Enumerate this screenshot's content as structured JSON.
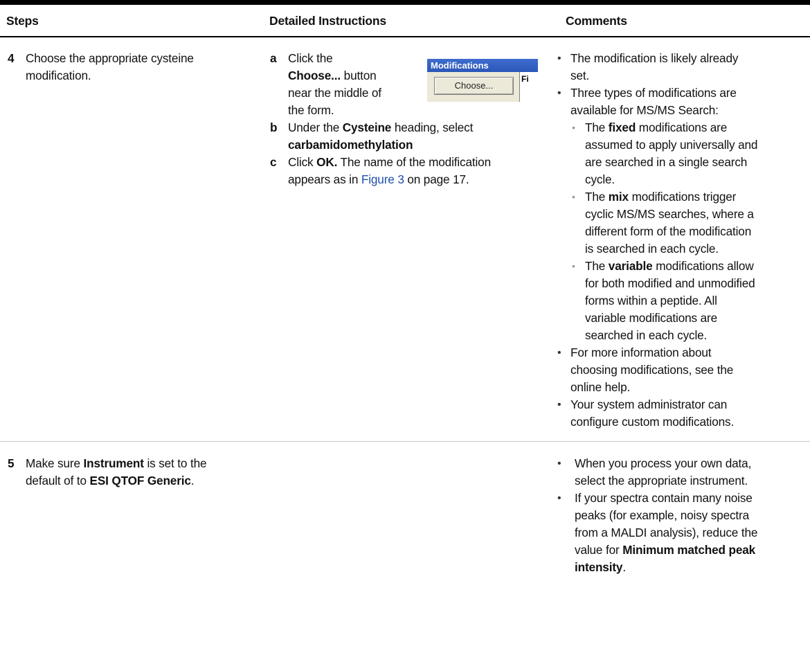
{
  "headers": {
    "steps": "Steps",
    "instructions": "Detailed Instructions",
    "comments": "Comments"
  },
  "step4": {
    "number": "4",
    "text": [
      "Choose the appropriate cysteine",
      "modification."
    ],
    "a_letter": "a",
    "a_lines": [
      "Click the",
      "button",
      "near the middle of",
      "the form."
    ],
    "a_bold": "Choose...",
    "b_letter": "b",
    "b_line1_pre": "Under the ",
    "b_line1_bold": "Cysteine",
    "b_line1_post": " heading, select",
    "b_line2_bold": "carbamidomethylation",
    "c_letter": "c",
    "c_line1_pre": "Click ",
    "c_line1_bold": "OK.",
    "c_line1_post": " The name of the modification",
    "c_line2_pre": "appears as in ",
    "c_line2_link": "Figure 3",
    "c_line2_post": " on page 17.",
    "modwin_title": "Modifications",
    "modwin_button": "Choose...",
    "modwin_side": "Fi",
    "comments": {
      "c1": [
        "The modification is likely already",
        "set."
      ],
      "c2": [
        "Three types of modifications are",
        "available for MS/MS Search:"
      ],
      "s1_pre": "The ",
      "s1_bold": "fixed",
      "s1_post": " modifications are",
      "s1_rest": [
        "assumed to apply universally and",
        "are searched in a single search",
        "cycle."
      ],
      "s2_pre": "The ",
      "s2_bold": "mix",
      "s2_post": " modifications trigger",
      "s2_rest": [
        "cyclic MS/MS searches, where a",
        "different form of the modification",
        "is searched in each cycle."
      ],
      "s3_pre": "The ",
      "s3_bold": "variable",
      "s3_post": " modifications allow",
      "s3_rest": [
        "for both modified and unmodified",
        "forms within a peptide. All",
        "variable modifications are",
        "searched in each cycle."
      ],
      "c3": [
        "For more information about",
        "choosing modifications, see the",
        "online help."
      ],
      "c4": [
        "Your system administrator can",
        "configure custom modifications."
      ]
    }
  },
  "step5": {
    "number": "5",
    "line1_pre": "Make sure ",
    "line1_bold": "Instrument",
    "line1_post": " is set to the",
    "line2_pre": "default of to ",
    "line2_bold": "ESI QTOF Generic",
    "line2_post": ".",
    "comments": {
      "c1": [
        "When you process your own data,",
        "select the appropriate instrument."
      ],
      "c2": [
        "If your spectra contain many noise",
        "peaks (for example, noisy spectra",
        "from a MALDI analysis), reduce the"
      ],
      "c2_last_pre": "value for ",
      "c2_last_bold": "Minimum matched peak",
      "c2_last2_bold": "intensity",
      "c2_last2_post": "."
    }
  },
  "glyphs": {
    "bullet": "•"
  }
}
